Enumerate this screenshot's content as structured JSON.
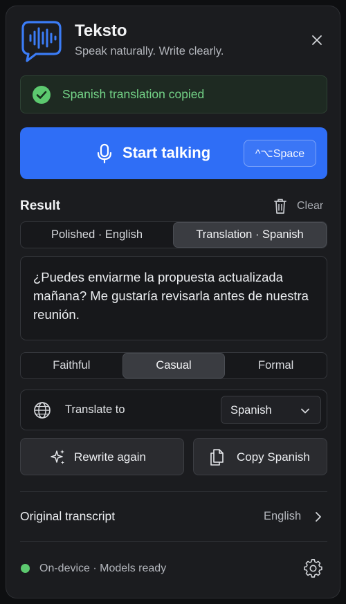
{
  "app": {
    "title": "Teksto",
    "subtitle": "Speak naturally. Write clearly.",
    "accent_color": "#2f6ef6",
    "icon": "audio-wave-chat-icon"
  },
  "toast": {
    "message": "Spanish translation copied",
    "icon": "check-circle-icon",
    "color": "#74d488"
  },
  "talk": {
    "label": "Start talking",
    "shortcut": "^⌥Space",
    "icon": "microphone-icon"
  },
  "result": {
    "heading": "Result",
    "clear_label": "Clear",
    "tabs": [
      {
        "label": "Polished · English",
        "active": false
      },
      {
        "label": "Translation · Spanish",
        "active": true
      }
    ],
    "text": "¿Puedes enviarme la propuesta actualizada mañana? Me gustaría revisarla antes de nuestra reunión."
  },
  "tone": {
    "options": [
      {
        "label": "Faithful",
        "active": false
      },
      {
        "label": "Casual",
        "active": true
      },
      {
        "label": "Formal",
        "active": false
      }
    ]
  },
  "translate": {
    "label": "Translate to",
    "selected": "Spanish",
    "icon": "globe-icon"
  },
  "actions": {
    "rewrite_label": "Rewrite again",
    "copy_label": "Copy Spanish"
  },
  "original": {
    "label": "Original transcript",
    "language": "English"
  },
  "status": {
    "text": "On-device · Models ready",
    "color": "#5cc96f"
  }
}
